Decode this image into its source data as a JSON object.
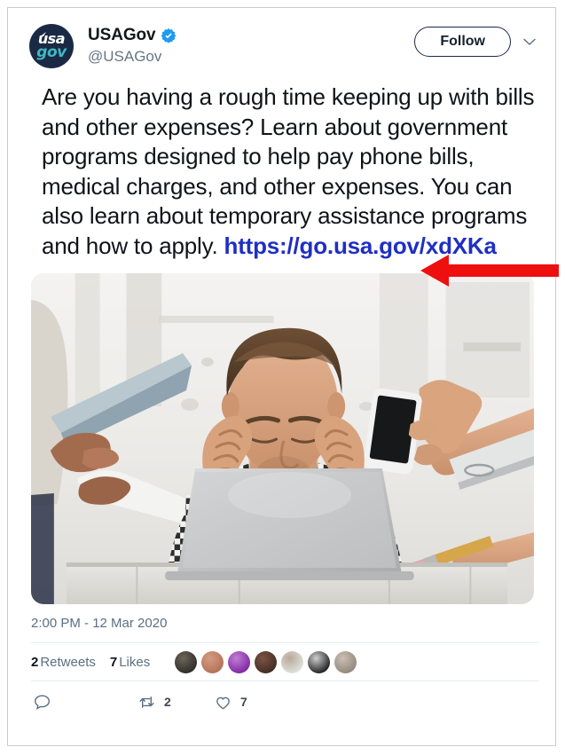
{
  "account": {
    "display_name": "USAGov",
    "handle": "@USAGov",
    "verified": true,
    "avatar_text_top": "usa",
    "avatar_text_bottom": "gov",
    "avatar_bg_color": "#1b2a44",
    "avatar_accent_color": "#3fb8c4",
    "verified_badge_color": "#1d9bf0"
  },
  "header": {
    "follow_label": "Follow",
    "more_icon": "chevron-down-icon"
  },
  "tweet": {
    "text_before_link": "Are you having a rough time keeping up with bills and other expenses? Learn about government programs designed to help pay phone bills, medical charges, and other expenses. You can also learn about temporary assistance programs and how to apply. ",
    "link_text": "https://go.usa.gov/xdXKa",
    "link_color": "#1f2fc4",
    "text_color": "#0f1419"
  },
  "annotation": {
    "type": "arrow",
    "direction": "left",
    "color": "#ee0f0f",
    "points_at": "https://go.usa.gov/xdXKa"
  },
  "media": {
    "alt": "Stressed man sitting at a white desk in front of a silver laptop, holding both hands to his temples, surrounded by hands holding a tablet, a smartphone, papers and a pencil",
    "description": "photo"
  },
  "meta": {
    "timestamp": "2:00 PM - 12 Mar 2020"
  },
  "stats": {
    "retweets_count": "2",
    "retweets_label": "Retweets",
    "likes_count": "7",
    "likes_label": "Likes",
    "liker_avatars": [
      {
        "name": "liker-avatar-1",
        "colors": [
          "#2a2724",
          "#6d655a"
        ]
      },
      {
        "name": "liker-avatar-2",
        "colors": [
          "#b06f56",
          "#d49b7f"
        ]
      },
      {
        "name": "liker-avatar-3",
        "colors": [
          "#7c1f9e",
          "#c07fd4"
        ]
      },
      {
        "name": "liker-avatar-4",
        "colors": [
          "#3a2a22",
          "#7d5443"
        ]
      },
      {
        "name": "liker-avatar-5",
        "colors": [
          "#e2e7e2",
          "#b9a89a"
        ]
      },
      {
        "name": "liker-avatar-6",
        "colors": [
          "#111111",
          "#cfcfcf"
        ]
      },
      {
        "name": "liker-avatar-7",
        "colors": [
          "#8d8378",
          "#cbbfb3"
        ]
      }
    ]
  },
  "actions": {
    "reply_icon": "reply-icon",
    "reply_count": "",
    "retweet_icon": "retweet-icon",
    "retweet_count": "2",
    "like_icon": "heart-icon",
    "like_count": "7"
  }
}
